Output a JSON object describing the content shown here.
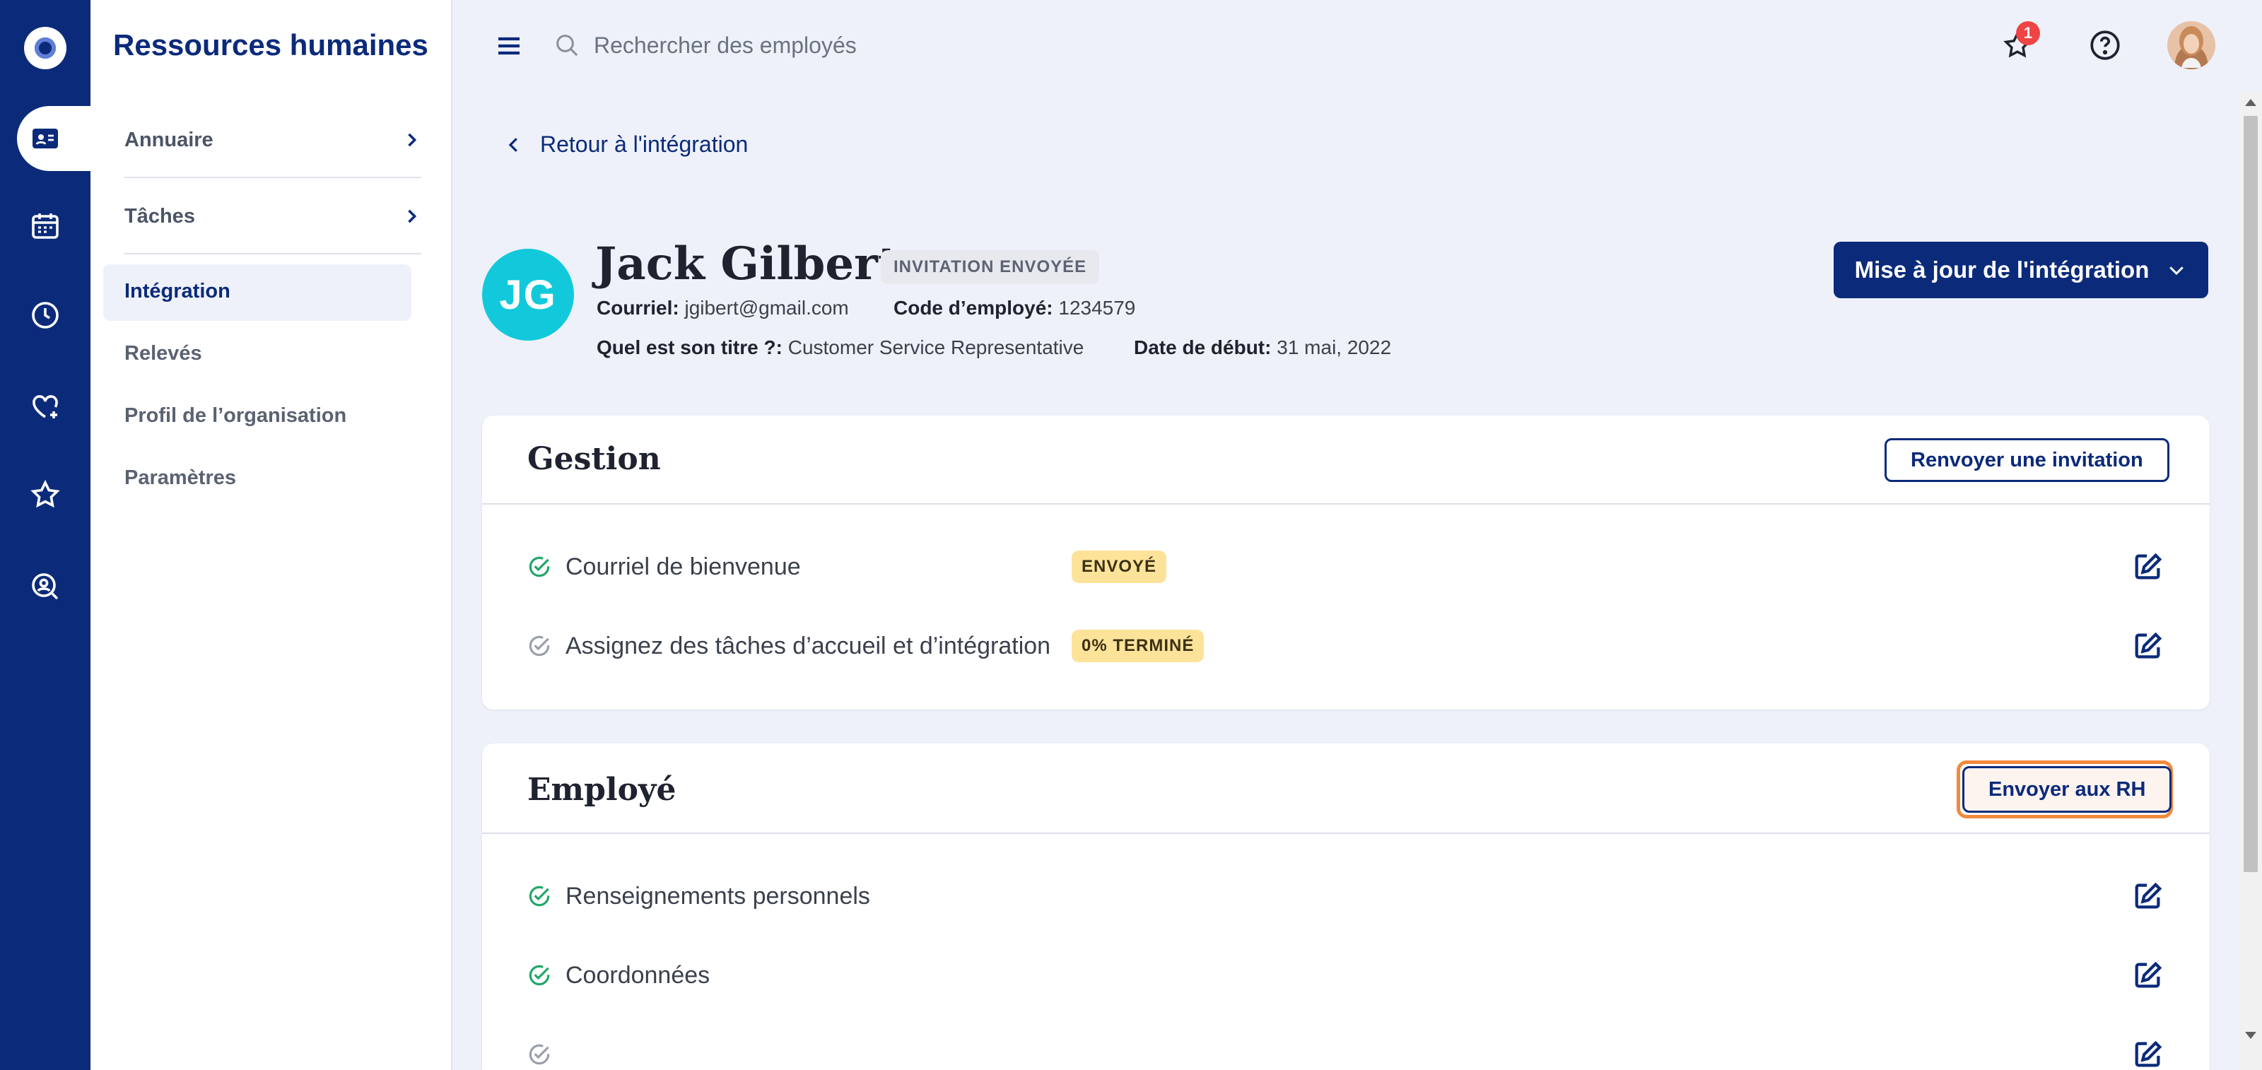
{
  "app": {
    "title": "Ressources humaines"
  },
  "rail": {
    "items": [
      {
        "icon": "logo-icon"
      },
      {
        "icon": "id-card-icon",
        "active": true
      },
      {
        "icon": "calendar-icon"
      },
      {
        "icon": "clock-icon"
      },
      {
        "icon": "heart-plus-icon"
      },
      {
        "icon": "star-icon"
      },
      {
        "icon": "user-search-icon"
      }
    ]
  },
  "subnav": {
    "items": [
      {
        "label": "Annuaire",
        "has_arrow": true
      },
      {
        "label": "Tâches",
        "has_arrow": true
      },
      {
        "label": "Intégration",
        "active": true
      },
      {
        "label": "Relevés"
      },
      {
        "label": "Profil de l’organisation"
      },
      {
        "label": "Paramètres"
      }
    ]
  },
  "topbar": {
    "search_placeholder": "Rechercher des employés",
    "notifications_count": "1"
  },
  "page": {
    "back_label": "Retour à l'intégration",
    "update_button": "Mise à jour de l'intégration"
  },
  "employee": {
    "initials": "JG",
    "name": "Jack Gilbert",
    "status": "INVITATION ENVOYÉE",
    "email_label": "Courriel:",
    "email": "jgibert@gmail.com",
    "code_label": "Code d’employé:",
    "code": "1234579",
    "title_label": "Quel est son titre ?:",
    "title": "Customer Service Representative",
    "start_label": "Date de début:",
    "start_date": "31 mai, 2022"
  },
  "gestion": {
    "title": "Gestion",
    "action": "Renvoyer une invitation",
    "tasks": [
      {
        "label": "Courriel de bienvenue",
        "done": true,
        "pill": "ENVOYÉ"
      },
      {
        "label": "Assignez des tâches d’accueil et d’intégration",
        "done": false,
        "pill": "0% TERMINÉ"
      }
    ]
  },
  "employe": {
    "title": "Employé",
    "action": "Envoyer aux RH",
    "tasks": [
      {
        "label": "Renseignements personnels",
        "done": true
      },
      {
        "label": "Coordonnées",
        "done": true
      }
    ]
  },
  "colors": {
    "brand": "#0b2a7a",
    "avatar": "#12c9dc",
    "success": "#22a66b",
    "pill_yellow": "#fde39a",
    "focus": "#f08a3c"
  }
}
